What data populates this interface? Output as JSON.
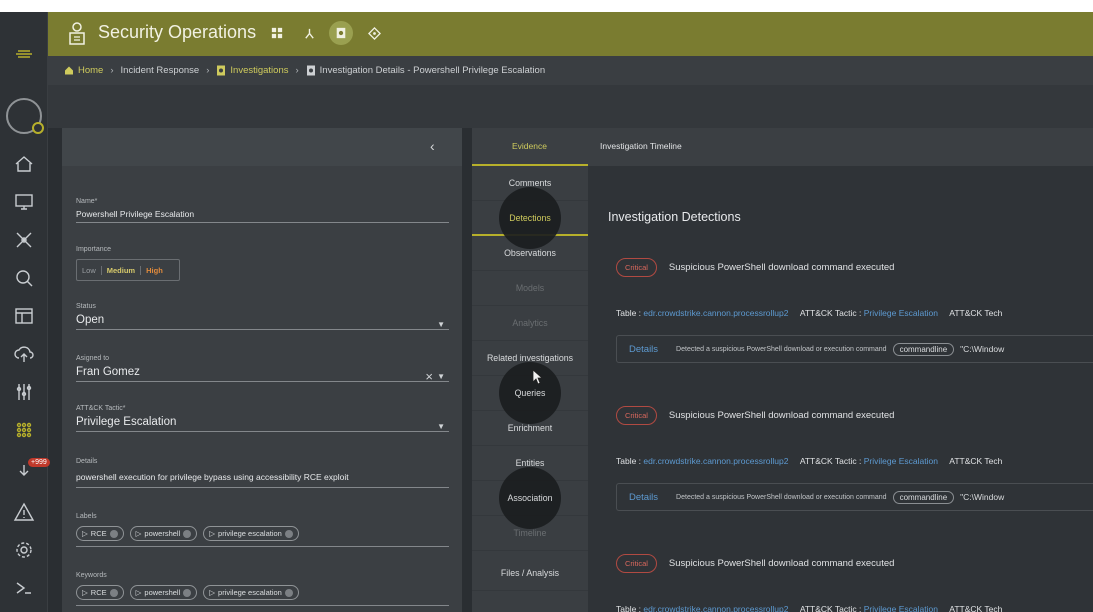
{
  "header": {
    "title": "Security Operations"
  },
  "breadcrumb": {
    "home": "Home",
    "incident_response": "Incident Response",
    "investigations": "Investigations",
    "current": "Investigation Details - Powershell Privilege Escalation"
  },
  "rail": {
    "badge": "+999"
  },
  "form": {
    "name_label": "Name*",
    "name_value": "Powershell Privilege Escalation",
    "importance_label": "Importance",
    "importance_options": [
      "Low",
      "Medium",
      "High"
    ],
    "importance_selected": "High",
    "status_label": "Status",
    "status_value": "Open",
    "assigned_label": "Asigned to",
    "assigned_value": "Fran Gomez",
    "tactic_label": "ATT&CK Tactic*",
    "tactic_value": "Privilege Escalation",
    "details_label": "Details",
    "details_value": "powershell execution for privilege bypass using accessibility RCE exploit",
    "labels_label": "Labels",
    "labels": [
      "RCE",
      "powershell",
      "privilege escalation"
    ],
    "keywords_label": "Keywords",
    "keywords": [
      "RCE",
      "powershell",
      "privilege escalation"
    ]
  },
  "tabs": {
    "evidence": "Evidence",
    "timeline": "Investigation Timeline"
  },
  "side_menu": [
    "Comments",
    "Detections",
    "Observations",
    "Models",
    "Analytics",
    "Related investigations",
    "Queries",
    "Enrichment",
    "Entities",
    "Association",
    "Timeline",
    "Files / Analysis"
  ],
  "detections": {
    "title": "Investigation Detections",
    "items": [
      {
        "severity": "Critical",
        "title": "Suspicious PowerShell download command executed",
        "table_label": "Table :",
        "table": "edr.crowdstrike.cannon.processrollup2",
        "tactic_label": "ATT&CK Tactic :",
        "tactic": "Privilege Escalation",
        "tech_label": "ATT&CK Tech",
        "details": "Details",
        "desc": "Detected a suspicious PowerShell download or execution command",
        "field": "commandline",
        "path": "\"C:\\Window"
      },
      {
        "severity": "Critical",
        "title": "Suspicious PowerShell download command executed",
        "table_label": "Table :",
        "table": "edr.crowdstrike.cannon.processrollup2",
        "tactic_label": "ATT&CK Tactic :",
        "tactic": "Privilege Escalation",
        "tech_label": "ATT&CK Tech",
        "details": "Details",
        "desc": "Detected a suspicious PowerShell download or execution command",
        "field": "commandline",
        "path": "\"C:\\Window"
      },
      {
        "severity": "Critical",
        "title": "Suspicious PowerShell download command executed",
        "table_label": "Table :",
        "table": "edr.crowdstrike.cannon.processrollup2",
        "tactic_label": "ATT&CK Tactic :",
        "tactic": "Privilege Escalation",
        "tech_label": "ATT&CK Tech"
      }
    ]
  },
  "colors": {
    "header": "#7a7c30",
    "accent": "#b7b02b",
    "link": "#5d9ad1",
    "critical": "#d9685d"
  }
}
